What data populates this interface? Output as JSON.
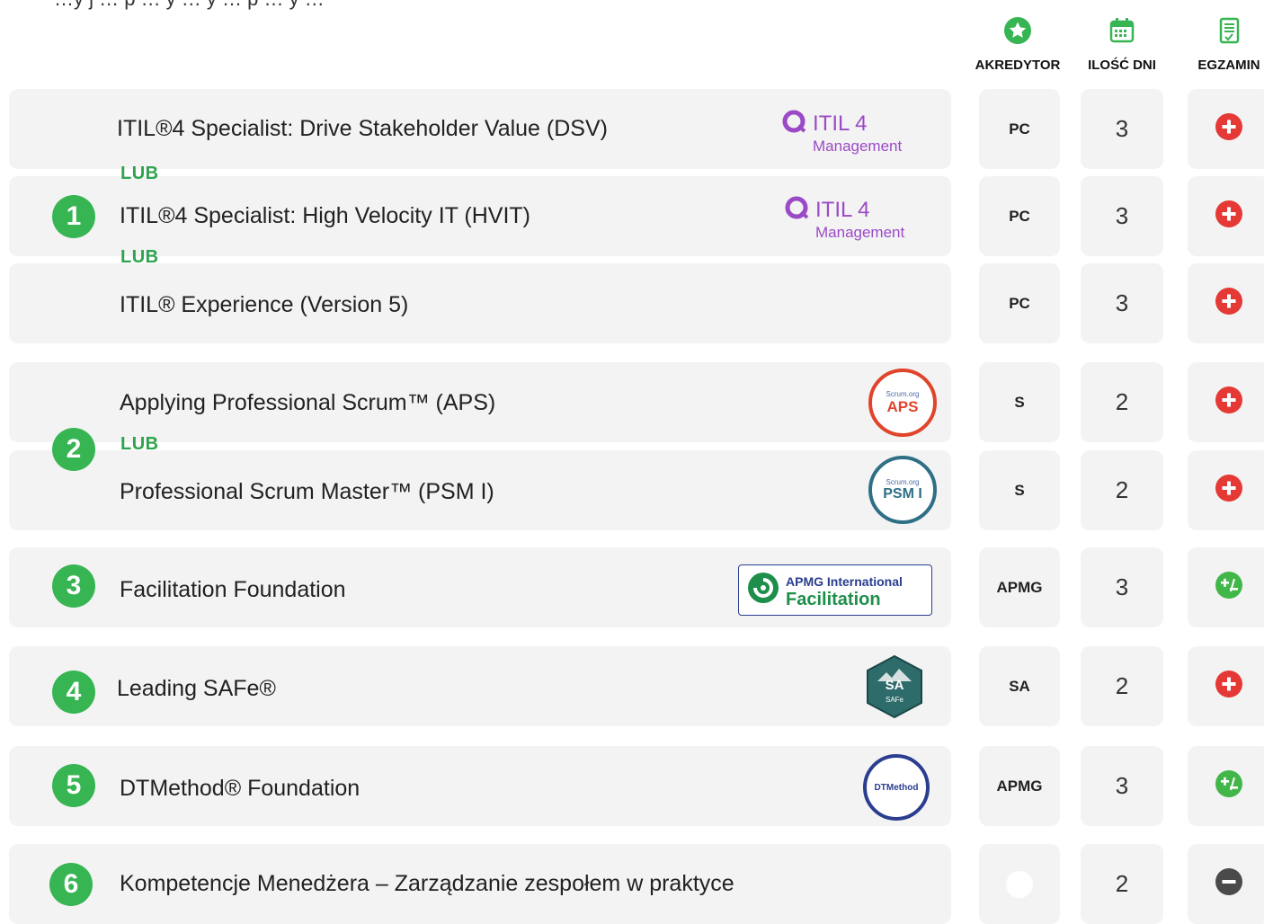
{
  "intro_text": "…y j … p … y … y … p … y …",
  "headers": {
    "accreditor": "AKREDYTOR",
    "days": "ILOŚĆ DNI",
    "exam": "EGZAMIN"
  },
  "lub_label": "LUB",
  "groups": [
    {
      "number": "1"
    },
    {
      "number": "2"
    },
    {
      "number": "3"
    },
    {
      "number": "4"
    },
    {
      "number": "5"
    },
    {
      "number": "6"
    }
  ],
  "courses": [
    {
      "title": "ITIL®4 Specialist: Drive Stakeholder Value (DSV)",
      "accreditor": "PC",
      "days": "3",
      "exam": "plus",
      "logo": "itil4-management-logo"
    },
    {
      "title": "ITIL®4 Specialist: High Velocity IT (HVIT)",
      "accreditor": "PC",
      "days": "3",
      "exam": "plus",
      "logo": "itil4-management-logo"
    },
    {
      "title": "ITIL® Experience (Version 5)",
      "accreditor": "PC",
      "days": "3",
      "exam": "plus",
      "logo": ""
    },
    {
      "title": "Applying Professional Scrum™ (APS)",
      "accreditor": "S",
      "days": "2",
      "exam": "plus",
      "logo": "aps-badge"
    },
    {
      "title": "Professional Scrum Master™ (PSM I)",
      "accreditor": "S",
      "days": "2",
      "exam": "plus",
      "logo": "psm-badge"
    },
    {
      "title": "Facilitation Foundation",
      "accreditor": "APMG",
      "days": "3",
      "exam": "plus-minus",
      "logo": "apmg-facilitation-logo"
    },
    {
      "title": "Leading SAFe®",
      "accreditor": "SA",
      "days": "2",
      "exam": "plus",
      "logo": "safe-badge"
    },
    {
      "title": "DTMethod® Foundation",
      "accreditor": "APMG",
      "days": "3",
      "exam": "plus-minus",
      "logo": "dtmethod-badge"
    },
    {
      "title": "Kompetencje Menedżera – Zarządzanie zespołem w praktyce",
      "accreditor": "",
      "days": "2",
      "exam": "minus",
      "logo": ""
    }
  ],
  "logos": {
    "itil_main": "ITIL 4",
    "itil_sub": "Management",
    "aps": "APS",
    "psm": "PSM I",
    "scrum_org": "Scrum.org",
    "apmg_top": "APMG International",
    "apmg_bottom": "Facilitation",
    "safe_sa": "SA",
    "safe_sub": "SAFe",
    "dt": "DTMethod"
  },
  "colors": {
    "green": "#36b552",
    "lub_green": "#2ea44f",
    "red": "#e53935",
    "exam_green": "#43b649",
    "neutral": "#4a4a4a",
    "card_bg": "#f3f3f3",
    "itil_purple": "#9b4ac7"
  }
}
